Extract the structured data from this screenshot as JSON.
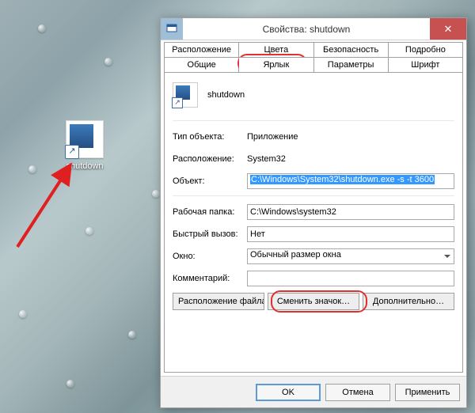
{
  "desktop": {
    "icon_label": "shutdown"
  },
  "dialog": {
    "title": "Свойства: shutdown",
    "tabs_row1": [
      "Расположение",
      "Цвета",
      "Безопасность",
      "Подробно"
    ],
    "tabs_row2": [
      "Общие",
      "Ярлык",
      "Параметры",
      "Шрифт"
    ],
    "active_tab": "Ярлык",
    "shortcut_name": "shutdown",
    "fields": {
      "type_label": "Тип объекта:",
      "type_value": "Приложение",
      "location_label": "Расположение:",
      "location_value": "System32",
      "target_label": "Объект:",
      "target_value": "C:\\Windows\\System32\\shutdown.exe -s -t 3600",
      "workdir_label": "Рабочая папка:",
      "workdir_value": "C:\\Windows\\system32",
      "hotkey_label": "Быстрый вызов:",
      "hotkey_value": "Нет",
      "runmode_label": "Окно:",
      "runmode_value": "Обычный размер окна",
      "comment_label": "Комментарий:",
      "comment_value": ""
    },
    "buttons": {
      "open_location": "Расположение файла",
      "change_icon": "Сменить значок…",
      "advanced": "Дополнительно…"
    },
    "footer": {
      "ok": "OK",
      "cancel": "Отмена",
      "apply": "Применить"
    }
  }
}
